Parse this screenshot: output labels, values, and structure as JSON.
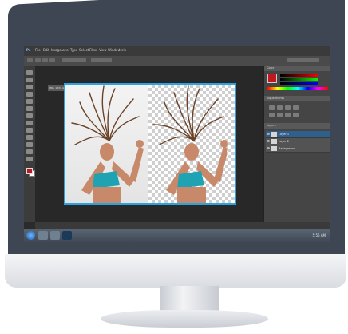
{
  "app": {
    "menu": [
      "Ps",
      "File",
      "Edit",
      "Image",
      "Layer",
      "Type",
      "Select",
      "Filter",
      "View",
      "Window",
      "Help"
    ],
    "document_tab": "IMG_1234.jpg @ 50%",
    "panels": {
      "color_header": "Color",
      "adjustments_header": "Adjustments",
      "layers_header": "Layers",
      "layers": [
        {
          "name": "Layer 1",
          "selected": true
        },
        {
          "name": "Layer 2",
          "selected": false
        },
        {
          "name": "Background",
          "selected": false
        }
      ]
    },
    "taskbar_clock": "5:56 AM"
  },
  "colors": {
    "foreground": "#c0181f",
    "background": "#ffffff",
    "selection_border": "#2aa3e0",
    "top_color": "#1fa3b3"
  },
  "icons": [
    "move-icon",
    "marquee-icon",
    "lasso-icon",
    "magic-wand-icon",
    "crop-icon",
    "eyedropper-icon",
    "brush-icon",
    "eraser-icon",
    "gradient-icon",
    "pen-icon",
    "type-icon",
    "hand-icon",
    "zoom-icon"
  ]
}
